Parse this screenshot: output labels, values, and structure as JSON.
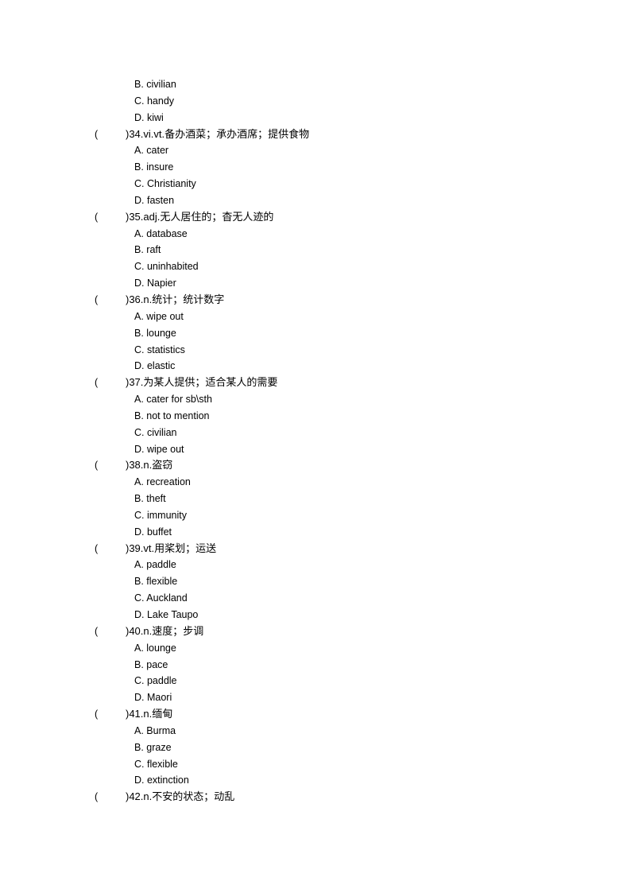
{
  "leading_options": [
    {
      "letter": "B",
      "text": "B. civilian"
    },
    {
      "letter": "C",
      "text": "C. handy"
    },
    {
      "letter": "D",
      "text": "D. kiwi"
    }
  ],
  "questions": [
    {
      "number": 34,
      "prompt": ")34.vi.vt.备办酒菜；承办酒席；提供食物",
      "paren": "(",
      "options": [
        "A. cater",
        "B. insure",
        "C. Christianity",
        "D. fasten"
      ]
    },
    {
      "number": 35,
      "prompt": ")35.adj.无人居住的；杳无人迹的",
      "paren": "(",
      "options": [
        "A. database",
        "B. raft",
        "C. uninhabited",
        "D. Napier"
      ]
    },
    {
      "number": 36,
      "prompt": ")36.n.统计；统计数字",
      "paren": "(",
      "options": [
        "A. wipe out",
        "B. lounge",
        "C. statistics",
        "D. elastic"
      ]
    },
    {
      "number": 37,
      "prompt": ")37.为某人提供；适合某人的需要",
      "paren": "(",
      "options": [
        "A. cater for sb\\sth",
        "B. not to mention",
        "C. civilian",
        "D. wipe out"
      ]
    },
    {
      "number": 38,
      "prompt": ")38.n.盗窃",
      "paren": "(",
      "options": [
        "A. recreation",
        "B. theft",
        "C. immunity",
        "D. buffet"
      ]
    },
    {
      "number": 39,
      "prompt": ")39.vt.用桨划；运送",
      "paren": "(",
      "options": [
        "A. paddle",
        "B. flexible",
        "C. Auckland",
        "D. Lake Taupo"
      ]
    },
    {
      "number": 40,
      "prompt": ")40.n.速度；步调",
      "paren": "(",
      "options": [
        "A. lounge",
        "B. pace",
        "C. paddle",
        "D. Maori"
      ]
    },
    {
      "number": 41,
      "prompt": ")41.n.缅甸",
      "paren": "(",
      "options": [
        "A. Burma",
        "B. graze",
        "C. flexible",
        "D. extinction"
      ]
    },
    {
      "number": 42,
      "prompt": ")42.n.不安的状态；动乱",
      "paren": "(",
      "options": []
    }
  ]
}
